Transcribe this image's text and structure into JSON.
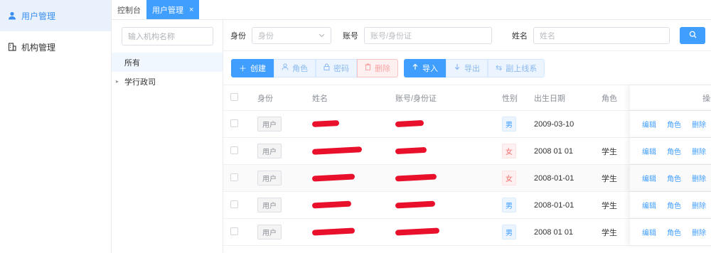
{
  "sidebar": {
    "items": [
      {
        "label": "用户管理",
        "icon": "user-icon",
        "active": true
      },
      {
        "label": "机构管理",
        "icon": "building-icon",
        "active": false
      }
    ]
  },
  "tabs": [
    {
      "label": "控制台",
      "active": false
    },
    {
      "label": "用户管理",
      "active": true,
      "close": "×"
    }
  ],
  "tree": {
    "search_placeholder": "输入机构名称",
    "nodes": [
      {
        "label": "所有",
        "active": true
      },
      {
        "label": "学行政司",
        "active": false,
        "arrow": "▸"
      }
    ]
  },
  "filters": {
    "role_label": "身份",
    "role_placeholder": "身份",
    "account_label": "账号",
    "account_placeholder": "账号/身份证",
    "name_label": "姓名",
    "name_placeholder": "姓名"
  },
  "toolbar": {
    "create": "创建",
    "role": "角色",
    "password": "密码",
    "delete": "删除",
    "import": "导入",
    "export": "导出",
    "switch": "副上线系"
  },
  "table": {
    "headers": {
      "role": "身份",
      "name": "姓名",
      "account": "账号/身份证",
      "sex": "性别",
      "birth": "出生日期",
      "jiao": "角色",
      "ops": "操作"
    },
    "rows": [
      {
        "role": "用户",
        "sex": "男",
        "birth": "2009-03-10",
        "jiao": ""
      },
      {
        "role": "用户",
        "sex": "女",
        "birth": "2008 01 01",
        "jiao": "学生"
      },
      {
        "role": "用户",
        "sex": "女",
        "birth": "2008-01-01",
        "jiao": "学生"
      },
      {
        "role": "用户",
        "sex": "男",
        "birth": "2008-01-01",
        "jiao": "学生"
      },
      {
        "role": "用户",
        "sex": "男",
        "birth": "2008 01 01",
        "jiao": "学生"
      }
    ],
    "ops": {
      "edit": "编辑",
      "role": "角色",
      "delete": "删除"
    }
  },
  "colors": {
    "primary": "#409eff",
    "redaction": "#e8102a",
    "sidebar_active_bg": "#e8f1fc"
  }
}
